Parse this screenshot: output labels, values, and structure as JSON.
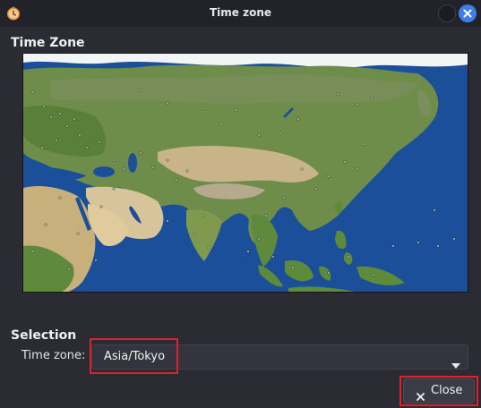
{
  "window": {
    "title": "Time zone"
  },
  "sections": {
    "time_zone_heading": "Time Zone",
    "selection_heading": "Selection"
  },
  "selection": {
    "label": "Time zone:",
    "value": "Asia/Tokyo"
  },
  "buttons": {
    "close_label": "Close"
  },
  "colors": {
    "accent": "#3d7ee8",
    "highlight": "#e0202a",
    "ocean": "#1b4f99"
  },
  "icons": {
    "app": "clock-icon",
    "minimize": "minimize-icon",
    "window_close": "close-icon",
    "dropdown": "chevron-down-icon",
    "close_button": "x-icon"
  }
}
